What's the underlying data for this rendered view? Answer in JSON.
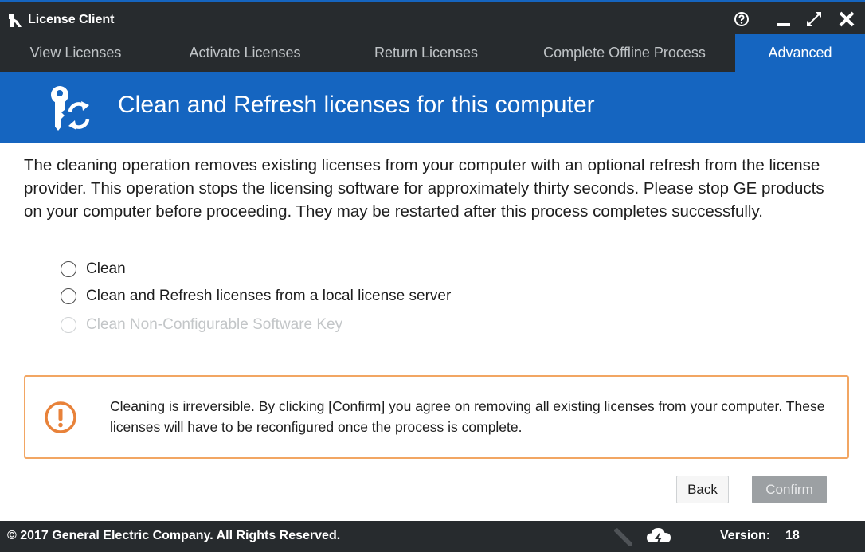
{
  "window": {
    "title": "License Client",
    "icons": [
      "app-logo-icon",
      "help-icon",
      "minimize-icon",
      "maximize-icon",
      "close-icon"
    ]
  },
  "tabs": [
    {
      "label": "View Licenses",
      "active": false
    },
    {
      "label": "Activate Licenses",
      "active": false
    },
    {
      "label": "Return Licenses",
      "active": false
    },
    {
      "label": "Complete Offline Process",
      "active": false
    },
    {
      "label": "Advanced",
      "active": true
    }
  ],
  "header": {
    "title": "Clean and Refresh licenses for this computer",
    "icon": "key-refresh-icon"
  },
  "description": "The cleaning operation removes existing licenses from your computer with an optional refresh from the license provider. This operation stops the licensing software for approximately thirty seconds. Please stop GE products on your computer before proceeding. They may be restarted after this process completes successfully.",
  "options": [
    {
      "label": "Clean",
      "enabled": true,
      "selected": false
    },
    {
      "label": "Clean and Refresh licenses from a local license server",
      "enabled": true,
      "selected": false
    },
    {
      "label": "Clean Non-Configurable Software Key",
      "enabled": false,
      "selected": false
    }
  ],
  "warning": {
    "icon": "exclamation-circle-icon",
    "text": "Cleaning is irreversible. By clicking [Confirm] you agree on removing all existing licenses from your computer. These licenses will have to be reconfigured once the process is complete."
  },
  "buttons": {
    "back": "Back",
    "confirm": "Confirm",
    "confirm_enabled": false
  },
  "footer": {
    "copyright": "© 2017 General Electric Company.  All Rights Reserved.",
    "version_label": "Version:",
    "version_value": "18",
    "icons": [
      "pen-icon",
      "cloud-lightning-icon"
    ]
  },
  "colors": {
    "accent": "#1565c0",
    "dark_bar": "#272b2e",
    "warning_border": "#f2a663",
    "warning_icon": "#e8823a"
  }
}
